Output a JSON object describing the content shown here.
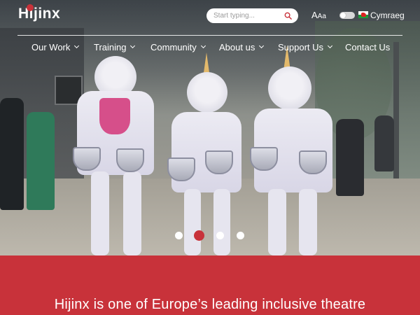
{
  "header": {
    "logo_text": "Hijinx",
    "search_placeholder": "Start typing...",
    "font_size_label_large": "A",
    "font_size_label_small": "Aa",
    "language_label": "Cymraeg"
  },
  "nav": {
    "items": [
      {
        "label": "Our Work",
        "has_dropdown": true
      },
      {
        "label": "Training",
        "has_dropdown": true
      },
      {
        "label": "Community",
        "has_dropdown": true
      },
      {
        "label": "About us",
        "has_dropdown": true
      },
      {
        "label": "Support Us",
        "has_dropdown": true
      },
      {
        "label": "Contact Us",
        "has_dropdown": false
      }
    ]
  },
  "carousel": {
    "slide_count": 4,
    "active_index": 1
  },
  "intro": {
    "headline": "Hijinx is one of Europe’s leading inclusive theatre"
  },
  "colors": {
    "brand_red": "#c8323a",
    "white": "#ffffff"
  },
  "icons": [
    "search-icon",
    "font-size-icon",
    "toggle-switch",
    "welsh-flag-icon",
    "chevron-down-icon"
  ]
}
